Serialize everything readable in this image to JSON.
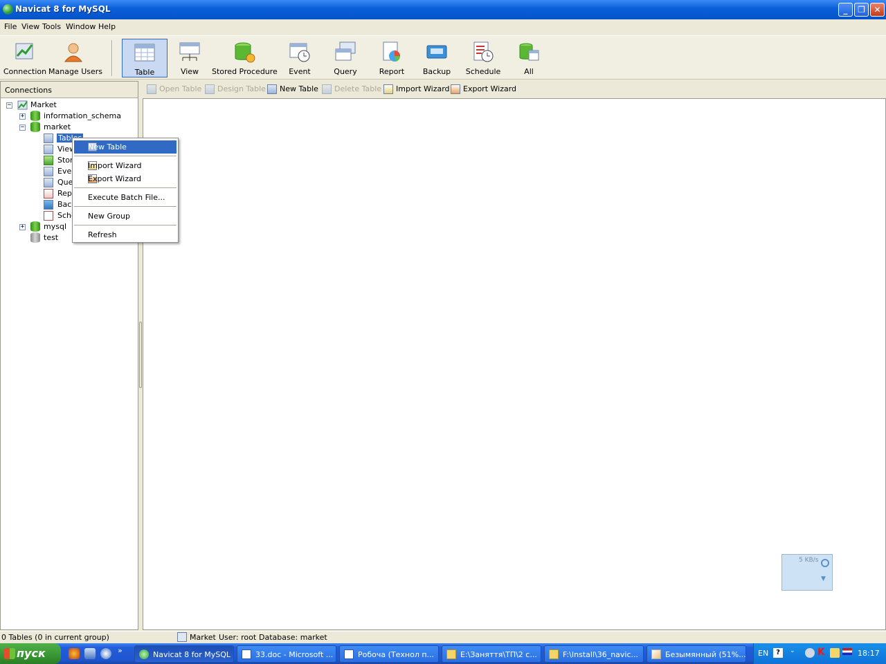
{
  "window": {
    "title": "Navicat 8 for MySQL",
    "min": "_",
    "restore": "❐",
    "close": "✕"
  },
  "menu": [
    "File",
    "View",
    "Tools",
    "Window",
    "Help"
  ],
  "toolbar": {
    "buttons": [
      {
        "label": "Connection",
        "icon": "connection-icon"
      },
      {
        "label": "Manage Users",
        "icon": "users-icon"
      },
      {
        "label": "Table",
        "icon": "table-icon",
        "active": true
      },
      {
        "label": "View",
        "icon": "view-icon"
      },
      {
        "label": "Stored Procedure",
        "icon": "stored-procedure-icon"
      },
      {
        "label": "Event",
        "icon": "event-icon"
      },
      {
        "label": "Query",
        "icon": "query-icon"
      },
      {
        "label": "Report",
        "icon": "report-icon"
      },
      {
        "label": "Backup",
        "icon": "backup-icon"
      },
      {
        "label": "Schedule",
        "icon": "schedule-icon"
      },
      {
        "label": "All",
        "icon": "all-icon"
      }
    ]
  },
  "connections": {
    "header": "Connections",
    "tree": [
      {
        "label": "Market"
      },
      {
        "label": "information_schema"
      },
      {
        "label": "market"
      },
      {
        "label": "Tables"
      },
      {
        "label": "View"
      },
      {
        "label": "Stor"
      },
      {
        "label": "Ever"
      },
      {
        "label": "Que"
      },
      {
        "label": "Rep"
      },
      {
        "label": "Back"
      },
      {
        "label": "Sche"
      },
      {
        "label": "mysql"
      },
      {
        "label": "test"
      }
    ]
  },
  "objbar": {
    "open": "Open Table",
    "design": "Design Table",
    "new": "New Table",
    "delete": "Delete Table",
    "import": "Import Wizard",
    "export": "Export Wizard"
  },
  "context_menu": {
    "new_table": "New Table",
    "import": "Import Wizard",
    "export": "Export Wizard",
    "batch": "Execute Batch File...",
    "new_group": "New Group",
    "refresh": "Refresh"
  },
  "status": {
    "left": "0 Tables (0 in current group)",
    "conn": "Market",
    "user": "User: root",
    "db": "Database: market"
  },
  "netmon": {
    "speed": "5 KB/s"
  },
  "taskbar": {
    "start": "пуск",
    "tasks": [
      "Navicat 8 for MySQL",
      "33.doc - Microsoft ...",
      "Робоча (Технол п...",
      "E:\\Заняття\\ТП\\2 с...",
      "F:\\Install\\36_navic...",
      "Безымянный (51%..."
    ],
    "lang": "EN",
    "time": "18:17"
  },
  "colors": {
    "accent": "#316ac5",
    "title": "#0a5fd8"
  }
}
